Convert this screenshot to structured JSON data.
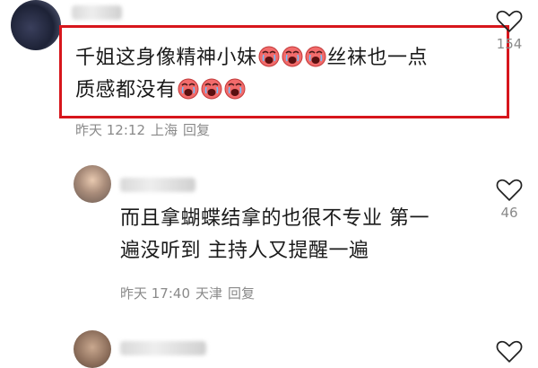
{
  "comments": [
    {
      "text_before": "千姐这身像精神小妹",
      "text_after_1": "丝袜也一点",
      "text_line2": "质感都没有",
      "time": "昨天 12:12",
      "location": "上海",
      "reply_label": "回复",
      "like_count": "154",
      "emoji_name": "crying-face-icon"
    },
    {
      "text_line1": "而且拿蝴蝶结拿的也很不专业 第一",
      "text_line2": "遍没听到 主持人又提醒一遍",
      "time": "昨天 17:40",
      "location": "天津",
      "reply_label": "回复",
      "like_count": "46"
    }
  ],
  "colors": {
    "highlight": "#d7161c",
    "meta": "#8a8a8a",
    "text": "#1a1a1a"
  }
}
